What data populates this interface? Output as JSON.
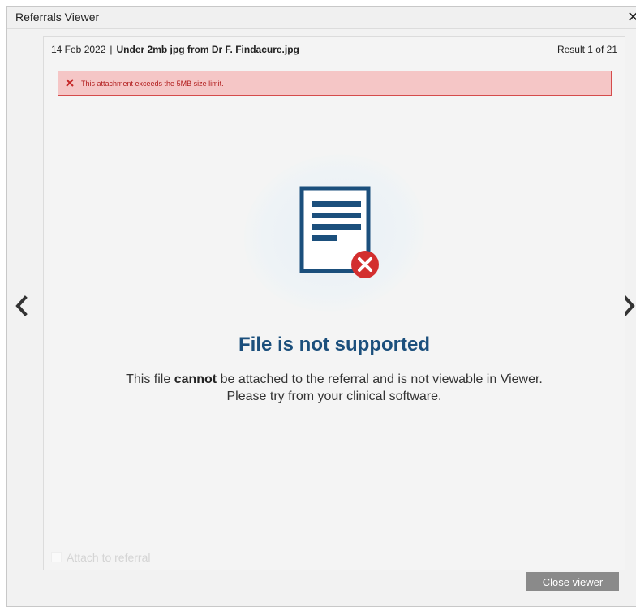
{
  "window": {
    "title": "Referrals Viewer",
    "close_glyph": "✕"
  },
  "meta": {
    "date": "14 Feb 2022",
    "separator": "|",
    "filename": "Under 2mb jpg from Dr F. Findacure.jpg",
    "result": "Result 1 of 21"
  },
  "error": {
    "message": "This attachment exceeds the 5MB size limit.",
    "icon": "x-icon",
    "color": "#b11d1d",
    "background": "#f5c6c6"
  },
  "content": {
    "icon": "unsupported-document-icon",
    "heading": "File is not supported",
    "line1_pre": "This file ",
    "line1_bold": "cannot",
    "line1_post": " be attached to the referral and is not viewable in Viewer.",
    "line2": "Please try from your clinical software.",
    "heading_color": "#1b4f7c"
  },
  "attach": {
    "label": "Attach to referral",
    "checked": false,
    "disabled": true
  },
  "navigation": {
    "prev_icon": "chevron-left-icon",
    "next_icon": "chevron-right-icon"
  },
  "footer": {
    "close_label": "Close viewer"
  }
}
